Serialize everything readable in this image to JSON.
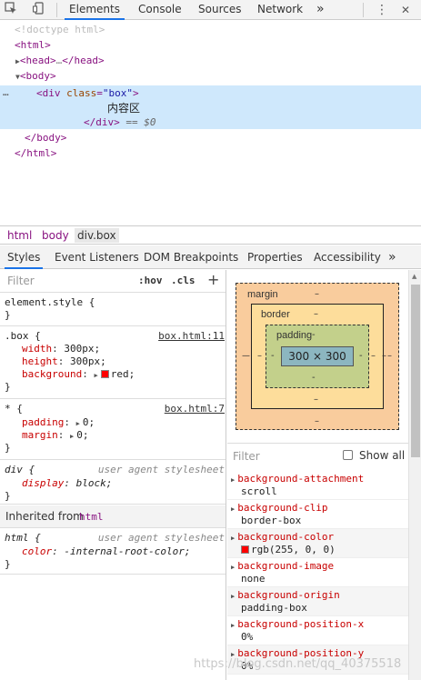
{
  "toolbar": {
    "tabs": [
      "Elements",
      "Console",
      "Sources",
      "Network"
    ],
    "more_tabs": "»",
    "menu": "⋮",
    "close": "✕"
  },
  "dom": {
    "doctype": "<!doctype html>",
    "html_open": "html",
    "head_open": "head",
    "head_ellipsis": "…",
    "head_close": "/head",
    "body_open": "body",
    "div_tag": "div",
    "div_attr": "class",
    "div_val": "\"box\"",
    "text_node": "内容区",
    "div_close": "/div",
    "eq": "== $0",
    "body_close": "/body",
    "html_close": "/html",
    "dots": "…"
  },
  "breadcrumb": [
    "html",
    "body",
    "div.box"
  ],
  "subtabs": {
    "tabs": [
      "Styles",
      "Event Listeners",
      "DOM Breakpoints",
      "Properties",
      "Accessibility"
    ],
    "more": "»"
  },
  "styles": {
    "filter_placeholder": "Filter",
    "hov": ":hov",
    "cls": ".cls",
    "add": "+",
    "element_style": "element.style {",
    "close_brace": "}",
    "box_selector": ".box {",
    "box_source": "box.html:11",
    "box_props": [
      {
        "name": "width",
        "value": "300px;"
      },
      {
        "name": "height",
        "value": "300px;"
      },
      {
        "name": "background",
        "value": "red;"
      }
    ],
    "star_selector": "* {",
    "star_source": "box.html:7",
    "star_props": [
      {
        "name": "padding",
        "value": "0;"
      },
      {
        "name": "margin",
        "value": "0;"
      }
    ],
    "div_selector": "div {",
    "ua_source": "user agent stylesheet",
    "div_prop": {
      "name": "display",
      "value": "block;"
    },
    "inherited_label": "Inherited from",
    "inherited_from": "html",
    "html_selector": "html {",
    "html_prop": {
      "name": "color",
      "value": "-internal-root-color;"
    }
  },
  "box_model": {
    "margin_label": "margin",
    "margin_value": "–",
    "border_label": "border",
    "border_value": "–",
    "padding_label": "padding",
    "padding_value": "-",
    "content": "300 × 300",
    "dash": "–",
    "colors": {
      "margin": "#f9cc9d",
      "border": "#fddd9b",
      "padding": "#c3d08b",
      "content": "#8cb6c0"
    }
  },
  "computed": {
    "filter_placeholder": "Filter",
    "show_all": "Show all",
    "props": [
      {
        "name": "background-attachment",
        "value": "scroll"
      },
      {
        "name": "background-clip",
        "value": "border-box"
      },
      {
        "name": "background-color",
        "value": "rgb(255, 0, 0)",
        "swatch": "#ff0000"
      },
      {
        "name": "background-image",
        "value": "none"
      },
      {
        "name": "background-origin",
        "value": "padding-box"
      },
      {
        "name": "background-position-x",
        "value": "0%"
      },
      {
        "name": "background-position-y",
        "value": "0%"
      }
    ]
  },
  "watermark": "https://blog.csdn.net/qq_40375518"
}
